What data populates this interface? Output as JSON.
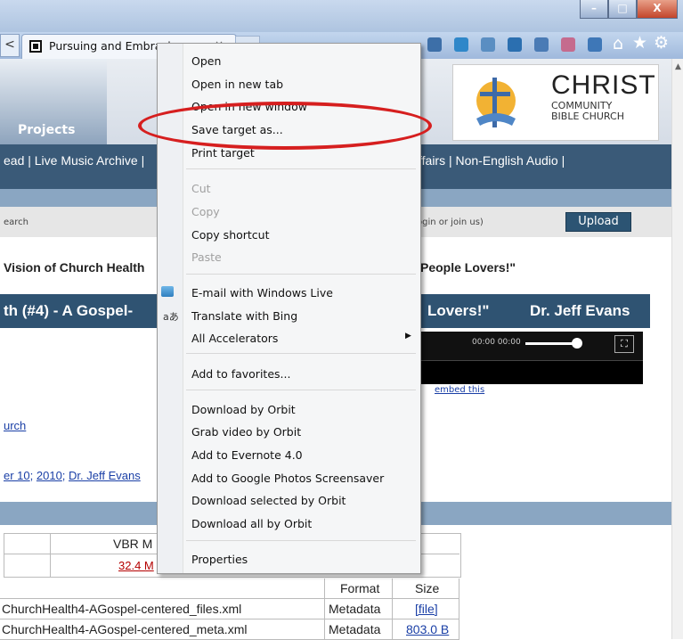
{
  "browser": {
    "tab_title": "Pursuing and Embracing a",
    "tab_close": "×",
    "back": "<",
    "window_buttons": [
      "–",
      "□",
      "X"
    ],
    "icons": [
      "home-icon",
      "star-icon",
      "gear-icon"
    ]
  },
  "page": {
    "projects": "Projects",
    "logo_title": "CHRIST",
    "logo_sub1": "COMMUNITY",
    "logo_sub2": "BIBLE CHURCH",
    "nav_left": "ead | Live Music Archive |",
    "nav_right": "ffairs | Non-English Audio |",
    "search_label": "earch",
    "join_label": "ogin or join us)",
    "upload_label": "Upload",
    "vision_left": "Vision of Church Health",
    "vision_right": "People Lovers!\"",
    "title_left": "th (#4) - A Gospel-",
    "title_mid": "Lovers!\"",
    "title_author": "Dr. Jeff Evans",
    "player_time": "00:00  00:00",
    "embed": "embed this",
    "church_link": "urch",
    "date_part1": "er 10",
    "date_part2": "2010",
    "date_author": "Dr. Jeff Evans",
    "vbr_header": "VBR M",
    "vbr_value": "32.4 M",
    "table": {
      "headers": [
        "",
        "Format",
        "Size"
      ],
      "rows": [
        [
          "ChurchHealth4-AGospel-centered_files.xml",
          "Metadata",
          "[file]"
        ],
        [
          "ChurchHealth4-AGospel-centered_meta.xml",
          "Metadata",
          "803.0 B"
        ]
      ]
    }
  },
  "context_menu": {
    "items": [
      {
        "label": "Open",
        "disabled": false
      },
      {
        "label": "Open in new tab",
        "disabled": false
      },
      {
        "label": "Open in new window",
        "disabled": false
      },
      {
        "label": "Save target as...",
        "disabled": false
      },
      {
        "label": "Print target",
        "disabled": false
      },
      {
        "label": "Cut",
        "disabled": true
      },
      {
        "label": "Copy",
        "disabled": true
      },
      {
        "label": "Copy shortcut",
        "disabled": false
      },
      {
        "label": "Paste",
        "disabled": true
      },
      {
        "label": "E-mail with Windows Live",
        "disabled": false
      },
      {
        "label": "Translate with Bing",
        "disabled": false
      },
      {
        "label": "All Accelerators",
        "disabled": false
      },
      {
        "label": "Add to favorites...",
        "disabled": false
      },
      {
        "label": "Download by Orbit",
        "disabled": false
      },
      {
        "label": "Grab video by Orbit",
        "disabled": false
      },
      {
        "label": "Add to Evernote 4.0",
        "disabled": false
      },
      {
        "label": "Add to Google Photos Screensaver",
        "disabled": false
      },
      {
        "label": "Download selected by Orbit",
        "disabled": false
      },
      {
        "label": "Download all by Orbit",
        "disabled": false
      },
      {
        "label": "Properties",
        "disabled": false
      }
    ],
    "submenu_arrow": "▶"
  },
  "annotation_color": "#d61f1f"
}
